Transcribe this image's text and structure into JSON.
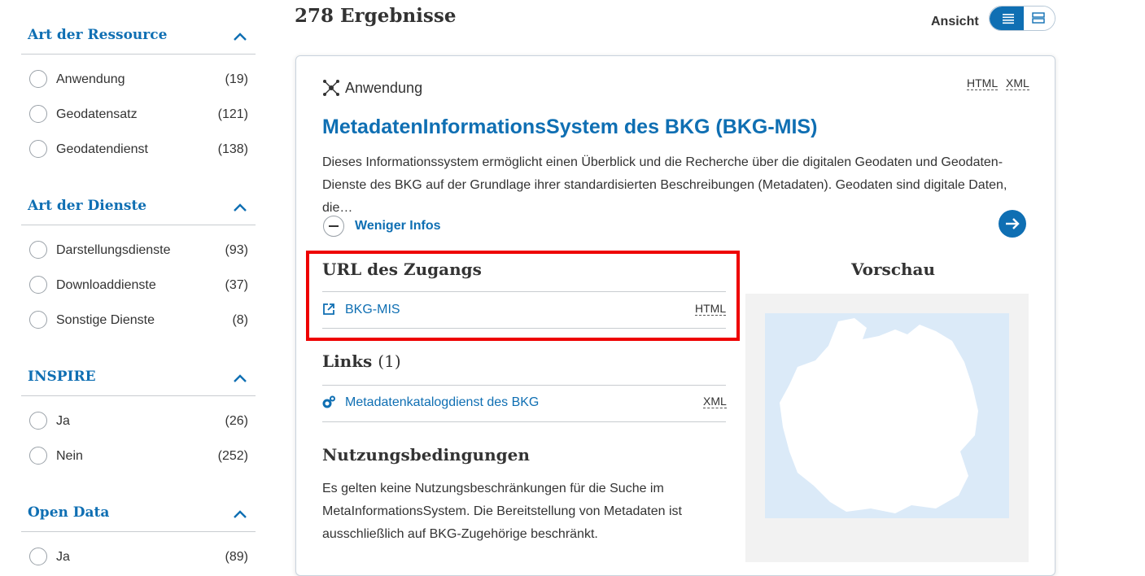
{
  "sidebar": {
    "facets": [
      {
        "title": "Art der Ressource",
        "options": [
          {
            "label": "Anwendung",
            "count": "(19)"
          },
          {
            "label": "Geodatensatz",
            "count": "(121)"
          },
          {
            "label": "Geodatendienst",
            "count": "(138)"
          }
        ]
      },
      {
        "title": "Art der Dienste",
        "options": [
          {
            "label": "Darstellungsdienste",
            "count": "(93)"
          },
          {
            "label": "Downloaddienste",
            "count": "(37)"
          },
          {
            "label": "Sonstige Dienste",
            "count": "(8)"
          }
        ]
      },
      {
        "title": "INSPIRE",
        "options": [
          {
            "label": "Ja",
            "count": "(26)"
          },
          {
            "label": "Nein",
            "count": "(252)"
          }
        ]
      },
      {
        "title": "Open Data",
        "options": [
          {
            "label": "Ja",
            "count": "(89)"
          }
        ]
      }
    ]
  },
  "header": {
    "results_count": "278 Ergebnisse",
    "view_label": "Ansicht"
  },
  "result": {
    "type_label": "Anwendung",
    "formats": [
      "HTML",
      "XML"
    ],
    "title": "MetadatenInformationsSystem des BKG (BKG-MIS)",
    "description": "Dieses Informationssystem ermöglicht einen Überblick und die Recherche über die digitalen Geodaten und Geodaten-Dienste des BKG auf der Grundlage ihrer standardisierten Beschreibungen (Metadaten). Geodaten sind digitale Daten, die…",
    "less_info_label": "Weniger Infos",
    "access": {
      "title": "URL des Zugangs",
      "link_label": "BKG-MIS",
      "link_format": "HTML"
    },
    "links": {
      "title": "Links",
      "count": "(1)",
      "items": [
        {
          "label": "Metadatenkatalogdienst des BKG",
          "format": "XML"
        }
      ]
    },
    "terms": {
      "title": "Nutzungsbedingungen",
      "text": "Es gelten keine Nutzungsbeschränkungen für die Suche im MetaInformationsSystem. Die Bereitstellung von Metadaten ist ausschließlich auf BKG-Zugehörige beschränkt."
    },
    "preview_title": "Vorschau"
  },
  "colors": {
    "accent": "#0f6fb3",
    "highlight": "#ee0000",
    "map_water": "#dbeaf8"
  }
}
